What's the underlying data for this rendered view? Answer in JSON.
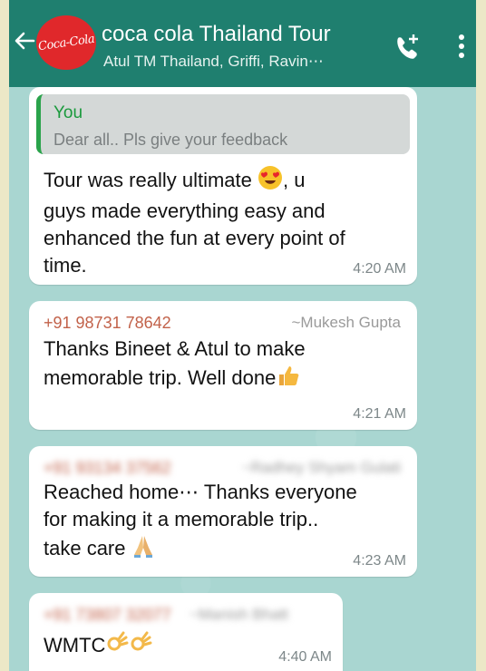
{
  "header": {
    "avatar_text": "Coca-Cola",
    "title": "coca cola Thailand Tour",
    "subtitle": "Atul TM Thailand, Griffi, Ravin⋯",
    "color": "#1f7f6f"
  },
  "messages": [
    {
      "quote_author": "You",
      "quote_text": "Dear all.. Pls give your feedback",
      "line1": "Tour was really ultimate",
      "line1_end": ", u",
      "line2": "guys made everything easy and",
      "line3": "enhanced the fun at every point of",
      "line4": "time.",
      "time": "4:20 AM",
      "emoji": "heart-eyes-face"
    },
    {
      "sender_number": "+91 98731 78642",
      "sender_name": "~Mukesh Gupta",
      "line1": "Thanks Bineet & Atul to make",
      "line2": "memorable trip. Well done",
      "time": "4:21 AM",
      "emoji": "thumbs-up"
    },
    {
      "sender_number": "+91 93134 37562",
      "sender_name": "~Radhey Shyam Gulati",
      "line1": "Reached home⋯ Thanks everyone",
      "line2": "for making it a memorable trip..",
      "line3": "take care",
      "time": "4:23 AM",
      "emoji": "folded-hands"
    },
    {
      "sender_number": "+91 73807 32077",
      "sender_name": "~Manish Bhatt",
      "line1": "WMTC",
      "time": "4:40 AM",
      "emoji": "ok-hand"
    }
  ]
}
